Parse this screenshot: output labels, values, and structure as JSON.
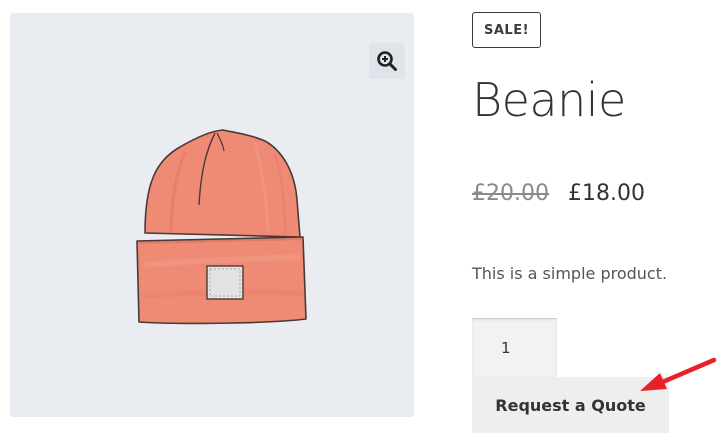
{
  "product": {
    "badge": "SALE!",
    "title": "Beanie",
    "price_old": "£20.00",
    "price_new": "£18.00",
    "short_description": "This is a simple product."
  },
  "gallery": {
    "zoom_icon": "magnifier-plus-icon",
    "image_alt": "Beanie"
  },
  "cart_form": {
    "quantity_value": "1",
    "quote_button_label": "Request a Quote"
  },
  "colors": {
    "gallery_bg": "#e9edf1",
    "button_bg": "#eeeeee",
    "text": "#333333",
    "annotation_arrow": "#e8202a",
    "beanie": "#ef8a75"
  }
}
